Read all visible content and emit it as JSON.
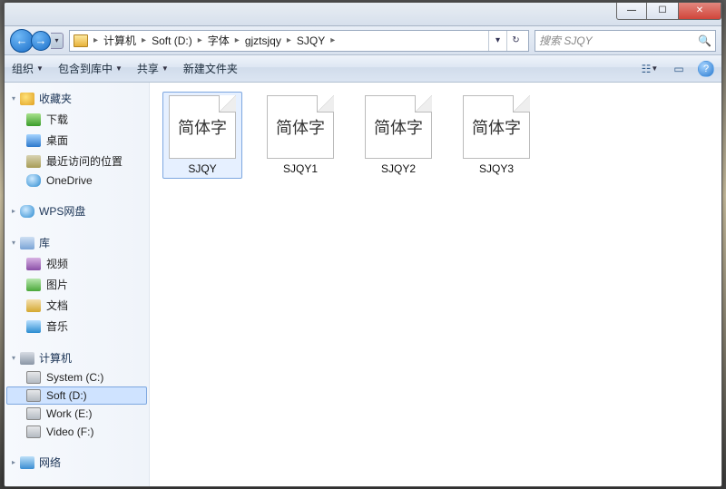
{
  "titlebar": {
    "min_glyph": "—",
    "max_glyph": "☐",
    "close_glyph": "✕"
  },
  "nav": {
    "back_glyph": "←",
    "fwd_glyph": "→",
    "dropdown_glyph": "▾",
    "refresh_glyph": "↻"
  },
  "breadcrumbs": {
    "sep": "▸",
    "items": [
      "计算机",
      "Soft (D:)",
      "字体",
      "gjztsjqy",
      "SJQY"
    ]
  },
  "search": {
    "placeholder": "搜索 SJQY",
    "icon_glyph": "🔍"
  },
  "toolbar": {
    "organize": "组织",
    "include": "包含到库中",
    "share": "共享",
    "newfolder": "新建文件夹",
    "drop_glyph": "▼",
    "view_glyph": "☷",
    "preview_glyph": "▭",
    "help_glyph": "?"
  },
  "sidebar": {
    "tri_open": "▾",
    "tri_closed": "▸",
    "favorites": {
      "label": "收藏夹",
      "items": [
        "下载",
        "桌面",
        "最近访问的位置",
        "OneDrive"
      ]
    },
    "wps": {
      "label": "WPS网盘"
    },
    "libraries": {
      "label": "库",
      "items": [
        "视频",
        "图片",
        "文档",
        "音乐"
      ]
    },
    "computer": {
      "label": "计算机",
      "items": [
        "System (C:)",
        "Soft (D:)",
        "Work (E:)",
        "Video (F:)"
      ]
    },
    "network": {
      "label": "网络"
    }
  },
  "files": {
    "thumb_text": "简体字",
    "items": [
      {
        "name": "SJQY",
        "selected": true
      },
      {
        "name": "SJQY1",
        "selected": false
      },
      {
        "name": "SJQY2",
        "selected": false
      },
      {
        "name": "SJQY3",
        "selected": false
      }
    ]
  }
}
